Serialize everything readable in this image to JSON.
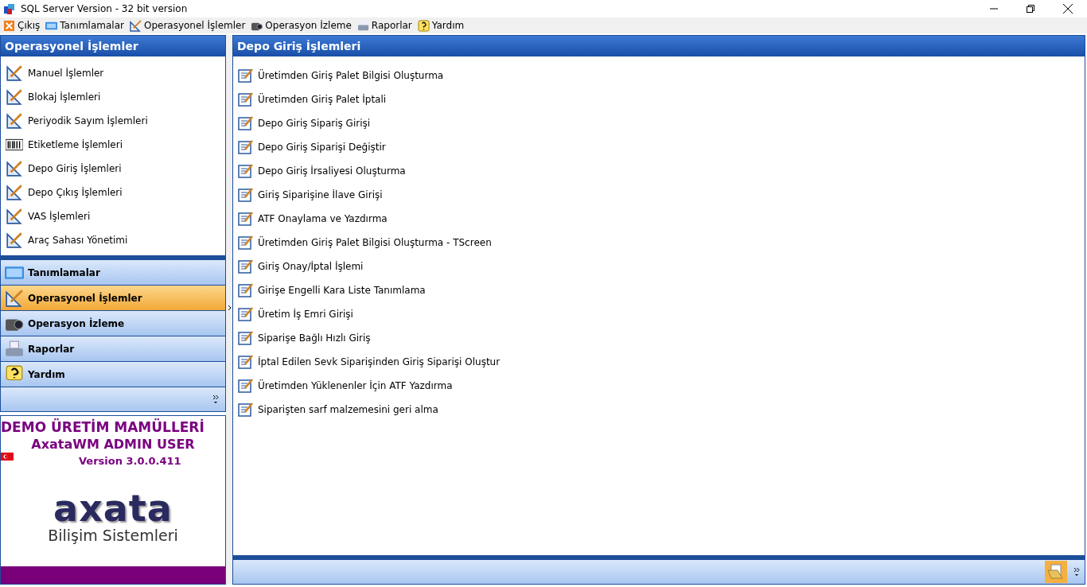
{
  "window": {
    "title": "SQL Server Version - 32 bit version"
  },
  "menu": [
    {
      "label": "Çıkış",
      "kind": "exit"
    },
    {
      "label": "Tanımlamalar",
      "kind": "keyboard"
    },
    {
      "label": "Operasyonel İşlemler",
      "kind": "tool"
    },
    {
      "label": "Operasyon İzleme",
      "kind": "camera"
    },
    {
      "label": "Raporlar",
      "kind": "printer"
    },
    {
      "label": "Yardım",
      "kind": "help"
    }
  ],
  "sidebar": {
    "title": "Operasyonel İşlemler",
    "items": [
      {
        "label": "Manuel İşlemler",
        "kind": "tool"
      },
      {
        "label": "Blokaj İşlemleri",
        "kind": "tool"
      },
      {
        "label": "Periyodik Sayım İşlemleri",
        "kind": "tool"
      },
      {
        "label": "Etiketleme İşlemleri",
        "kind": "barcode"
      },
      {
        "label": "Depo Giriş İşlemleri",
        "kind": "tool"
      },
      {
        "label": "Depo Çıkış İşlemleri",
        "kind": "tool"
      },
      {
        "label": "VAS İşlemleri",
        "kind": "tool"
      },
      {
        "label": "Araç Sahası Yönetimi",
        "kind": "tool"
      }
    ],
    "groups": [
      {
        "label": "Tanımlamalar",
        "kind": "keyboard",
        "selected": false
      },
      {
        "label": "Operasyonel İşlemler",
        "kind": "tool",
        "selected": true
      },
      {
        "label": "Operasyon İzleme",
        "kind": "camera",
        "selected": false
      },
      {
        "label": "Raporlar",
        "kind": "printer",
        "selected": false
      },
      {
        "label": "Yardım",
        "kind": "help",
        "selected": false
      }
    ]
  },
  "info": {
    "company": "DEMO ÜRETİM MAMÜLLERİ",
    "user": "AxataWM ADMIN USER",
    "version": "Version 3.0.0.411",
    "logo": "axata",
    "logo_subtitle": "Bilişim Sistemleri"
  },
  "main": {
    "title": "Depo Giriş İşlemleri",
    "items": [
      "Üretimden Giriş Palet Bilgisi Oluşturma",
      "Üretimden Giriş Palet İptali",
      "Depo Giriş Sipariş Girişi",
      "Depo Giriş Siparişi Değiştir",
      "Depo Giriş İrsaliyesi Oluşturma",
      "Giriş Siparişine İlave Girişi",
      "ATF Onaylama ve Yazdırma",
      "Üretimden Giriş Palet Bilgisi Oluşturma - TScreen",
      "Giriş Onay/İptal İşlemi",
      "Girişe Engelli Kara Liste Tanımlama",
      "Üretim İş Emri Girişi",
      "Siparişe Bağlı Hızlı Giriş",
      "İptal Edilen Sevk Siparişinden Giriş Siparişi Oluştur",
      "Üretimden Yüklenenler İçin ATF Yazdırma",
      "Siparişten sarf malzemesini geri alma"
    ]
  }
}
